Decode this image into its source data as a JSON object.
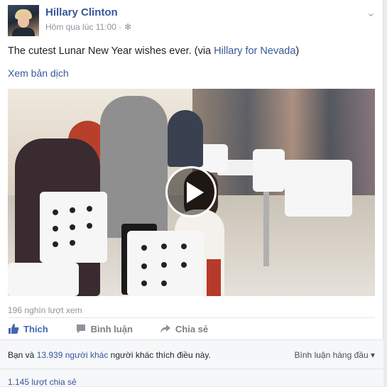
{
  "post": {
    "author": "Hillary Clinton",
    "timestamp": "Hôm qua lúc 11:00 ·",
    "privacy_icon": "globe-gear-icon",
    "text_before": "The cutest Lunar New Year wishes ever. (via ",
    "text_link": "Hillary for Nevada",
    "text_after": ")",
    "translate": "Xem bản dịch",
    "views": "196 nghìn lượt xem"
  },
  "actions": {
    "like": "Thích",
    "comment": "Bình luận",
    "share": "Chia sẻ"
  },
  "footer": {
    "likes_prefix": "Bạn và ",
    "likes_link": "13.939 người khác",
    "likes_suffix": " người khác thích điều này.",
    "sort": "Bình luận hàng đầu ▾",
    "shares": "1.145 lượt chia sẻ"
  },
  "colors": {
    "link": "#365899",
    "like_active": "#4267b2",
    "muted": "#90949c"
  }
}
